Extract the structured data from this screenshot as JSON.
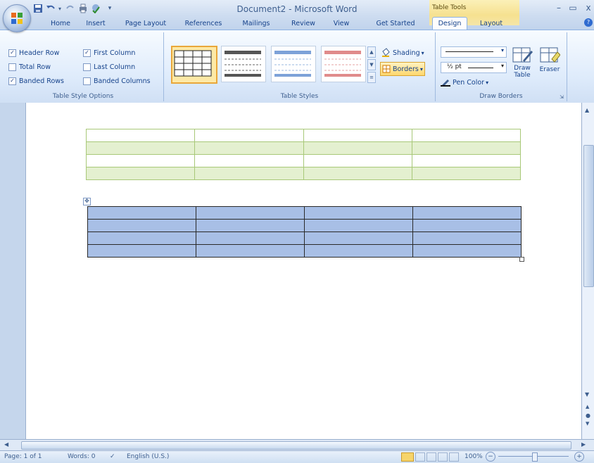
{
  "app": {
    "document_title": "Document2 - Microsoft Word",
    "context_tab_group": "Table Tools",
    "window_controls": [
      "–",
      "▭",
      "x"
    ]
  },
  "quick_access": [
    "save-icon",
    "undo-icon",
    "redo-icon",
    "print-icon",
    "spellcheck-icon",
    "customize-qat-icon"
  ],
  "tabs": [
    "Home",
    "Insert",
    "Page Layout",
    "References",
    "Mailings",
    "Review",
    "View",
    "Get Started",
    "Design",
    "Layout"
  ],
  "active_tab": "Design",
  "ribbon": {
    "table_style_options": {
      "label": "Table Style Options",
      "checkboxes": [
        {
          "label": "Header Row",
          "checked": true
        },
        {
          "label": "First Column",
          "checked": true
        },
        {
          "label": "Total Row",
          "checked": false
        },
        {
          "label": "Last Column",
          "checked": false
        },
        {
          "label": "Banded Rows",
          "checked": true
        },
        {
          "label": "Banded Columns",
          "checked": false
        }
      ],
      "check_mark": "✓"
    },
    "table_styles": {
      "label": "Table Styles"
    },
    "shading_label": "Shading",
    "borders_label": "Borders",
    "draw_borders": {
      "label": "Draw Borders",
      "pen_weight": "½ pt",
      "pen_color_label": "Pen Color",
      "draw_table_label": "Draw Table",
      "eraser_label": "Eraser"
    }
  },
  "status": {
    "page": "Page: 1 of 1",
    "words": "Words: 0",
    "language": "English (U.S.)",
    "zoom": "100%"
  },
  "colors": {
    "ribbon_accent": "#15428b",
    "table1_border": "#a8c878",
    "table1_band": "#e4f0d0",
    "table2_fill": "#a8bfe6",
    "context_tab": "#f6e190"
  }
}
